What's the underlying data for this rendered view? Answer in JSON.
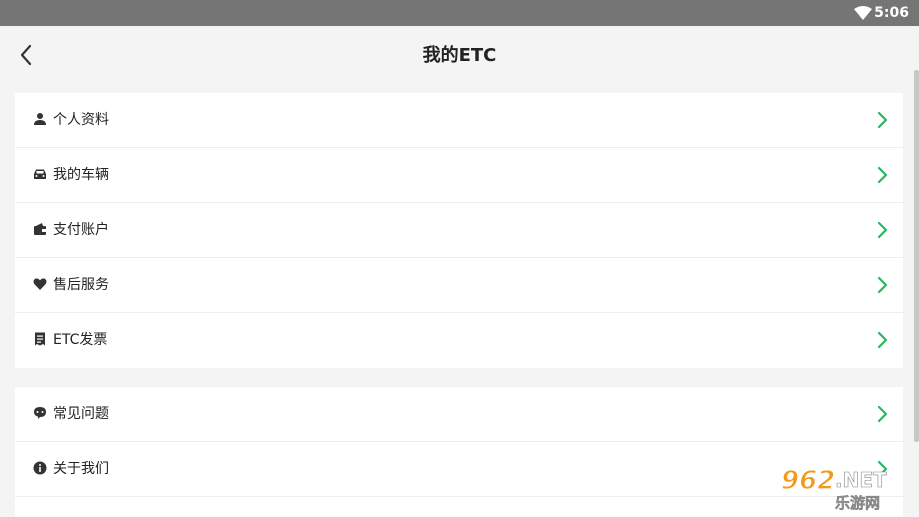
{
  "status_bar": {
    "time": "5:06"
  },
  "header": {
    "title": "我的ETC"
  },
  "menu_groups": [
    [
      {
        "label": "个人资料",
        "icon": "person-icon"
      },
      {
        "label": "我的车辆",
        "icon": "car-icon"
      },
      {
        "label": "支付账户",
        "icon": "wallet-icon"
      },
      {
        "label": "售后服务",
        "icon": "heart-icon"
      },
      {
        "label": "ETC发票",
        "icon": "receipt-icon"
      }
    ],
    [
      {
        "label": "常见问题",
        "icon": "help-bubble-icon"
      },
      {
        "label": "关于我们",
        "icon": "info-icon"
      }
    ]
  ],
  "watermark": {
    "top": "962.NET",
    "bottom": "乐游网"
  },
  "colors": {
    "accent": "#2db55d",
    "status_bar": "#757575",
    "background": "#f4f4f4"
  }
}
